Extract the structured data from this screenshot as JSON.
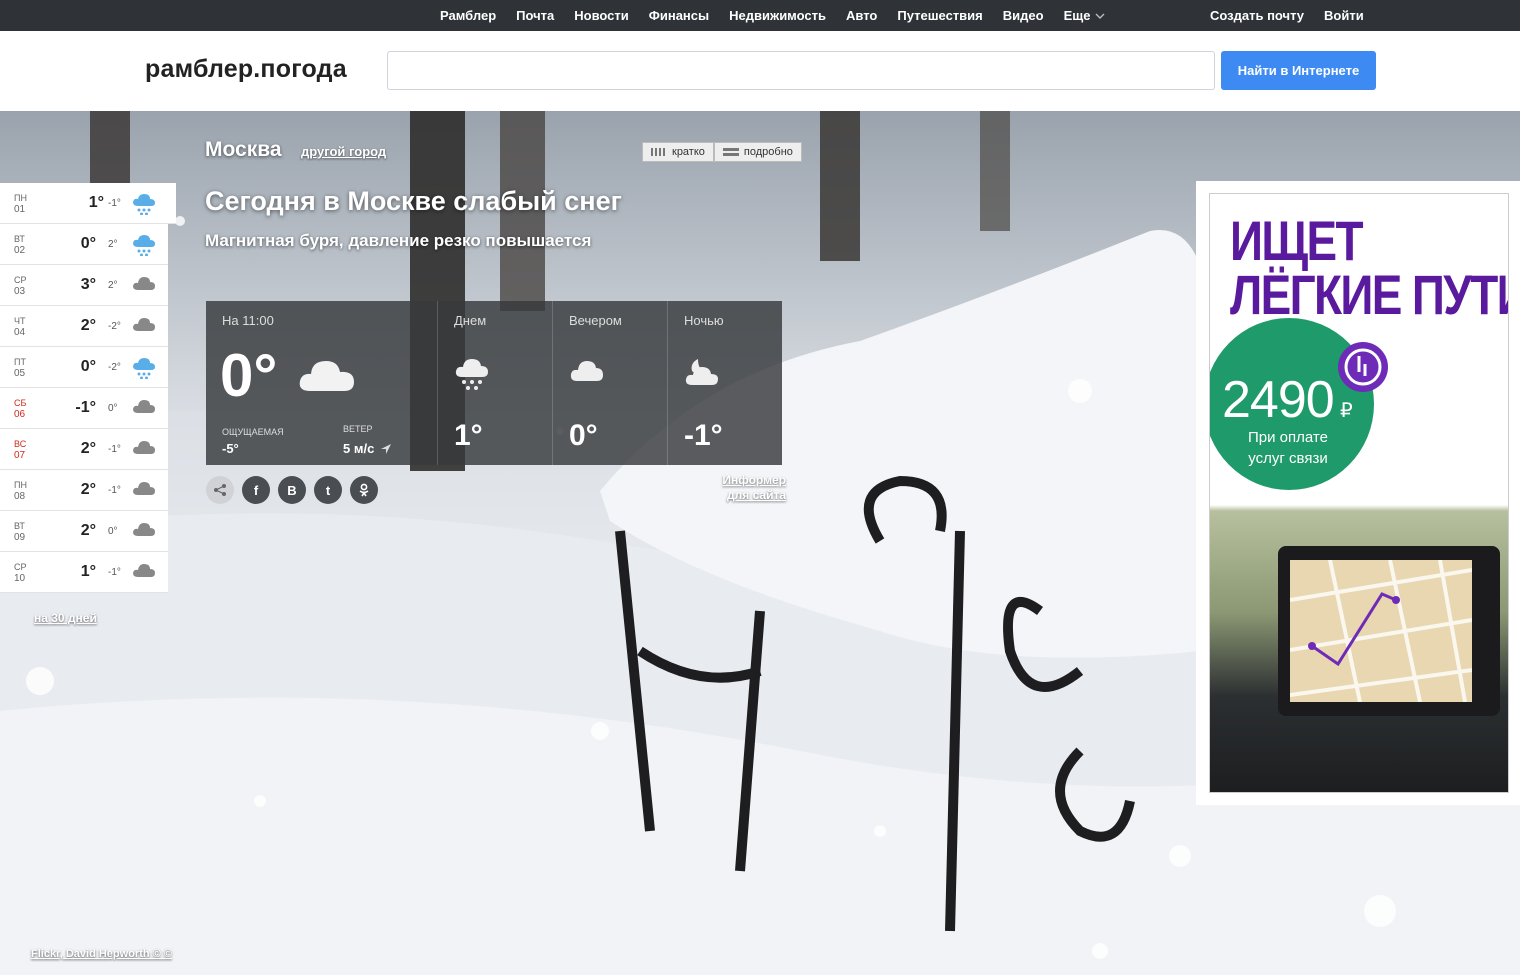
{
  "topnav": {
    "links": [
      "Рамблер",
      "Почта",
      "Новости",
      "Финансы",
      "Недвижимость",
      "Авто",
      "Путешествия",
      "Видео"
    ],
    "more": "Еще",
    "create_mail": "Создать почту",
    "login": "Войти"
  },
  "header": {
    "logo": "рамблер.погода",
    "search_value": "",
    "search_button": "Найти в Интернете"
  },
  "weather": {
    "city": "Москва",
    "other_city": "другой город",
    "view_brief": "кратко",
    "view_detailed": "подробно",
    "headline": "Сегодня в Москве слабый снег",
    "subheadline": "Магнитная буря, давление резко повышается",
    "now": {
      "title": "На 11:00",
      "temp": "0°",
      "icon": "cloud-icon",
      "feels_label": "ОЩУЩАЕМАЯ",
      "feels_value": "-5°",
      "wind_label": "ВЕТЕР",
      "wind_value": "5 м/с"
    },
    "parts": [
      {
        "title": "Днем",
        "temp": "1°",
        "icon": "snow-cloud-icon"
      },
      {
        "title": "Вечером",
        "temp": "0°",
        "icon": "cloud-icon"
      },
      {
        "title": "Ночью",
        "temp": "-1°",
        "icon": "moon-cloud-icon"
      }
    ],
    "share_icons": [
      "share-icon",
      "facebook-icon",
      "vk-icon",
      "twitter-icon",
      "odnoklassniki-icon"
    ],
    "share_labels": [
      "",
      "f",
      "B",
      "t",
      ""
    ],
    "informer": "Информер для сайта",
    "days": [
      {
        "dow": "ПН",
        "date": "01",
        "max": "1°",
        "min": "-1°",
        "icon": "snow-cloud-icon",
        "weekend": false
      },
      {
        "dow": "ВТ",
        "date": "02",
        "max": "0°",
        "min": "2°",
        "icon": "snow-cloud-icon",
        "weekend": false
      },
      {
        "dow": "СР",
        "date": "03",
        "max": "3°",
        "min": "2°",
        "icon": "cloud-icon",
        "weekend": false
      },
      {
        "dow": "ЧТ",
        "date": "04",
        "max": "2°",
        "min": "-2°",
        "icon": "cloud-icon",
        "weekend": false
      },
      {
        "dow": "ПТ",
        "date": "05",
        "max": "0°",
        "min": "-2°",
        "icon": "snow-cloud-icon",
        "weekend": false
      },
      {
        "dow": "СБ",
        "date": "06",
        "max": "-1°",
        "min": "0°",
        "icon": "cloud-icon",
        "weekend": true
      },
      {
        "dow": "ВС",
        "date": "07",
        "max": "2°",
        "min": "-1°",
        "icon": "cloud-icon",
        "weekend": true
      },
      {
        "dow": "ПН",
        "date": "08",
        "max": "2°",
        "min": "-1°",
        "icon": "cloud-icon",
        "weekend": false
      },
      {
        "dow": "ВТ",
        "date": "09",
        "max": "2°",
        "min": "0°",
        "icon": "cloud-icon",
        "weekend": false
      },
      {
        "dow": "СР",
        "date": "10",
        "max": "1°",
        "min": "-1°",
        "icon": "cloud-icon",
        "weekend": false
      }
    ],
    "days_link": "на 30 дней"
  },
  "ad": {
    "title_line1": "ИЩЕТ",
    "title_line2": "ЛЁГКИЕ ПУТИ",
    "price": "2490",
    "currency": "₽",
    "subtitle": "При оплате услуг связи"
  },
  "credit": "Flickr, David Hepworth © ©",
  "colors": {
    "accent_blue": "#3d8bf2",
    "topnav_bg": "#2f3237",
    "ad_purple": "#5a1a9e",
    "ad_green": "#1f9a6a",
    "weekend_red": "#d02a1a",
    "snow_icon_blue": "#5aaee8"
  }
}
